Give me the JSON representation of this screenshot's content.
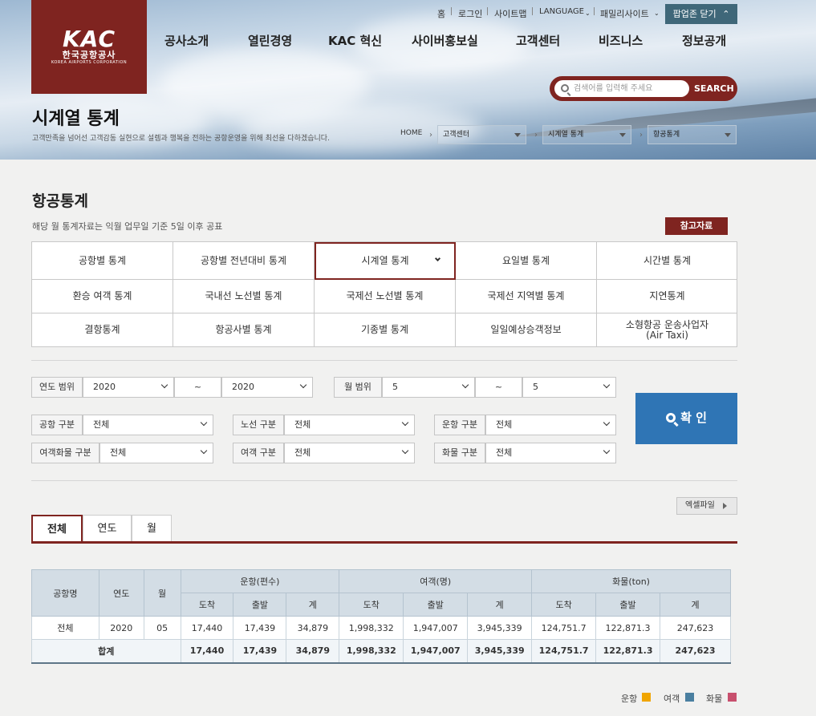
{
  "logo": {
    "mark": "KAC",
    "korean": "한국공항공사",
    "english": "KOREA AIRPORTS CORPORATION"
  },
  "util_nav": [
    "홈",
    "로그인",
    "사이트맵",
    "LANGUAGE",
    "패밀리사이트"
  ],
  "popup_toggle": "팝업존 닫기",
  "gnb": [
    "공사소개",
    "열린경영",
    "KAC 혁신",
    "사이버홍보실",
    "고객센터",
    "비즈니스",
    "정보공개"
  ],
  "search": {
    "placeholder": "검색어를 입력해 주세요",
    "button": "SEARCH"
  },
  "page": {
    "title": "시계열 통계",
    "subtitle": "고객만족을 넘어선 고객감동 실현으로 설렘과 행복을 전하는 공항운영을 위해 최선을 다하겠습니다."
  },
  "breadcrumb": {
    "home": "HOME",
    "level1": "고객센터",
    "level2": "시계열 통계",
    "level3": "항공통계"
  },
  "section": {
    "title": "항공통계",
    "note": "해당 월 통계자료는 익월 업무일 기준 5일 이후 공표",
    "ref_button": "참고자료"
  },
  "stat_tabs": [
    [
      "공항별 통계",
      "공항별 전년대비 통계",
      "시계열 통계",
      "요일별 통계",
      "시간별 통계"
    ],
    [
      "환승 여객 통계",
      "국내선 노선별 통계",
      "국제선 노선별 통계",
      "국제선 지역별 통계",
      "지연통계"
    ],
    [
      "결항통계",
      "항공사별 통계",
      "기종별 통계",
      "일일예상승객정보",
      "소형항공 운송사업자\n(Air Taxi)"
    ]
  ],
  "active_tab": "시계열 통계",
  "filters": {
    "year_range_label": "연도 범위",
    "year_from": "2020",
    "tilde": "~",
    "year_to": "2020",
    "month_range_label": "월 범위",
    "month_from": "5",
    "month_to": "5",
    "airport_label": "공항 구분",
    "airport_value": "전체",
    "route_label": "노선 구분",
    "route_value": "전체",
    "operation_label": "운항 구분",
    "operation_value": "전체",
    "passenger_cargo_label": "여객화물 구분",
    "passenger_cargo_value": "전체",
    "passenger_label": "여객 구분",
    "passenger_value": "전체",
    "cargo_label": "화물 구분",
    "cargo_value": "전체",
    "confirm": "확 인"
  },
  "excel_button": "엑셀파일",
  "result_tabs": [
    "전체",
    "연도",
    "월"
  ],
  "table": {
    "headers": {
      "airport": "공항명",
      "year": "연도",
      "month": "월",
      "flights": "운항(편수)",
      "passengers": "여객(명)",
      "cargo": "화물(ton)"
    },
    "sub_headers": [
      "도착",
      "출발",
      "계"
    ],
    "rows": [
      [
        "전체",
        "2020",
        "05",
        "17,440",
        "17,439",
        "34,879",
        "1,998,332",
        "1,947,007",
        "3,945,339",
        "124,751.7",
        "122,871.3",
        "247,623"
      ]
    ],
    "total": {
      "label": "합계",
      "values": [
        "17,440",
        "17,439",
        "34,879",
        "1,998,332",
        "1,947,007",
        "3,945,339",
        "124,751.7",
        "122,871.3",
        "247,623"
      ]
    }
  },
  "legend": [
    {
      "label": "운항",
      "color": "#f0a500"
    },
    {
      "label": "여객",
      "color": "#4a7fa0"
    },
    {
      "label": "화물",
      "color": "#c8506e"
    }
  ]
}
